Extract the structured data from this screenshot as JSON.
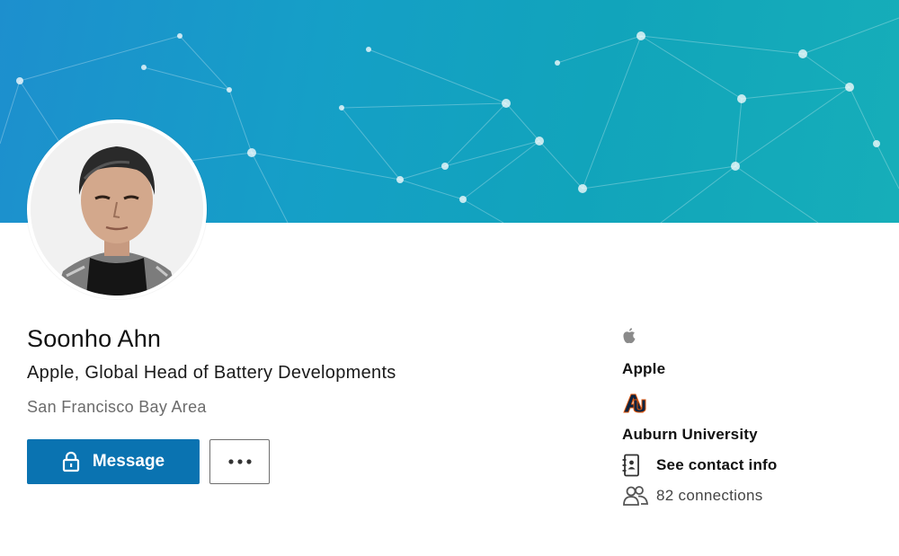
{
  "profile": {
    "name": "Soonho Ahn",
    "headline": "Apple, Global Head of Battery Developments",
    "location": "San Francisco Bay Area"
  },
  "actions": {
    "message_label": "Message",
    "more_label": "..."
  },
  "sidebar": {
    "company": "Apple",
    "school": "Auburn University",
    "contact_info": "See contact info",
    "connections": "82 connections"
  },
  "icons": {
    "company_logo": "apple-logo-icon",
    "school_logo": "auburn-logo-icon",
    "contact": "contact-card-icon",
    "connections": "people-icon",
    "message": "lock-icon",
    "more": "ellipsis-icon"
  },
  "colors": {
    "accent": "#0a73b1",
    "banner_start": "#1d8fce",
    "banner_end": "#16aeb9",
    "school_navy": "#0c2340",
    "school_orange": "#dd550c"
  }
}
